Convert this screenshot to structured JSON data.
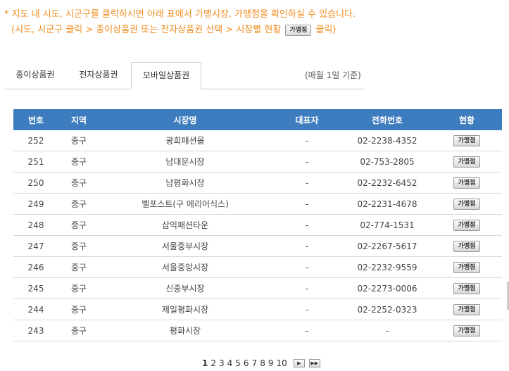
{
  "notice": {
    "line1": "* 지도 내 시도, 시군구를 클릭하시면 아래 표에서 가맹시장, 가맹점을 확인하실 수 있습니다.",
    "line2_prefix": "(시도, 시군구 클릭 > 종이상품권 또는 전자상품권 선택 > 시장별 현황",
    "line2_button": "가맹점",
    "line2_suffix": "클릭)"
  },
  "tabs": [
    {
      "label": "종이상품권"
    },
    {
      "label": "전자상품권"
    },
    {
      "label": "모바일상품권"
    }
  ],
  "basis": "(매월 1일 기준)",
  "table": {
    "headers": [
      "번호",
      "지역",
      "시장명",
      "대표자",
      "전화번호",
      "현황"
    ],
    "rows": [
      {
        "no": "252",
        "region": "중구",
        "market": "광희패션몰",
        "rep": "-",
        "phone": "02-2238-4352",
        "btn": "가맹점"
      },
      {
        "no": "251",
        "region": "중구",
        "market": "남대문시장",
        "rep": "-",
        "phone": "02-753-2805",
        "btn": "가맹점"
      },
      {
        "no": "250",
        "region": "중구",
        "market": "남평화시장",
        "rep": "-",
        "phone": "02-2232-6452",
        "btn": "가맹점"
      },
      {
        "no": "249",
        "region": "중구",
        "market": "벨포스트(구 에리어식스)",
        "rep": "-",
        "phone": "02-2231-4678",
        "btn": "가맹점"
      },
      {
        "no": "248",
        "region": "중구",
        "market": "삼익패션타운",
        "rep": "-",
        "phone": "02-774-1531",
        "btn": "가맹점"
      },
      {
        "no": "247",
        "region": "중구",
        "market": "서울중부시장",
        "rep": "-",
        "phone": "02-2267-5617",
        "btn": "가맹점"
      },
      {
        "no": "246",
        "region": "중구",
        "market": "서울중앙시장",
        "rep": "-",
        "phone": "02-2232-9559",
        "btn": "가맹점"
      },
      {
        "no": "245",
        "region": "중구",
        "market": "신중부시장",
        "rep": "-",
        "phone": "02-2273-0006",
        "btn": "가맹점"
      },
      {
        "no": "244",
        "region": "중구",
        "market": "제일평화시장",
        "rep": "-",
        "phone": "02-2252-0323",
        "btn": "가맹점"
      },
      {
        "no": "243",
        "region": "중구",
        "market": "평화시장",
        "rep": "-",
        "phone": "-",
        "btn": "가맹점"
      }
    ]
  },
  "pagination": {
    "pages": [
      "1",
      "2",
      "3",
      "4",
      "5",
      "6",
      "7",
      "8",
      "9",
      "10"
    ],
    "current": "1",
    "next_icon": "▶",
    "last_icon": "▶▶"
  },
  "colors": {
    "notice": "#f08c1e",
    "header_bg": "#3d7cbe"
  }
}
